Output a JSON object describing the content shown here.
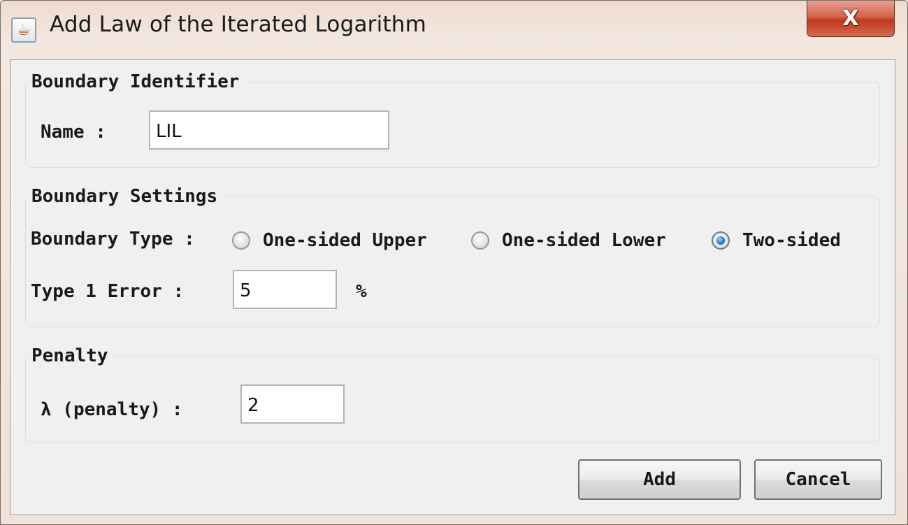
{
  "window": {
    "title": "Add Law of the Iterated Logarithm",
    "app_icon": "java-icon",
    "close_glyph": "X"
  },
  "boundary_identifier": {
    "legend": "Boundary Identifier",
    "name_label": "Name :",
    "name_value": "LIL"
  },
  "boundary_settings": {
    "legend": "Boundary Settings",
    "type_label": "Boundary Type :",
    "options": [
      {
        "label": "One-sided Upper",
        "selected": false
      },
      {
        "label": "One-sided Lower",
        "selected": false
      },
      {
        "label": "Two-sided",
        "selected": true
      }
    ],
    "error_label": "Type 1 Error :",
    "error_value": "5",
    "error_unit": "%"
  },
  "penalty": {
    "legend": "Penalty",
    "lambda_label": "λ (penalty) :",
    "lambda_value": "2"
  },
  "buttons": {
    "add": "Add",
    "cancel": "Cancel"
  },
  "colors": {
    "close_button": "#c8452b",
    "selected_radio": "#2a7ad0"
  }
}
